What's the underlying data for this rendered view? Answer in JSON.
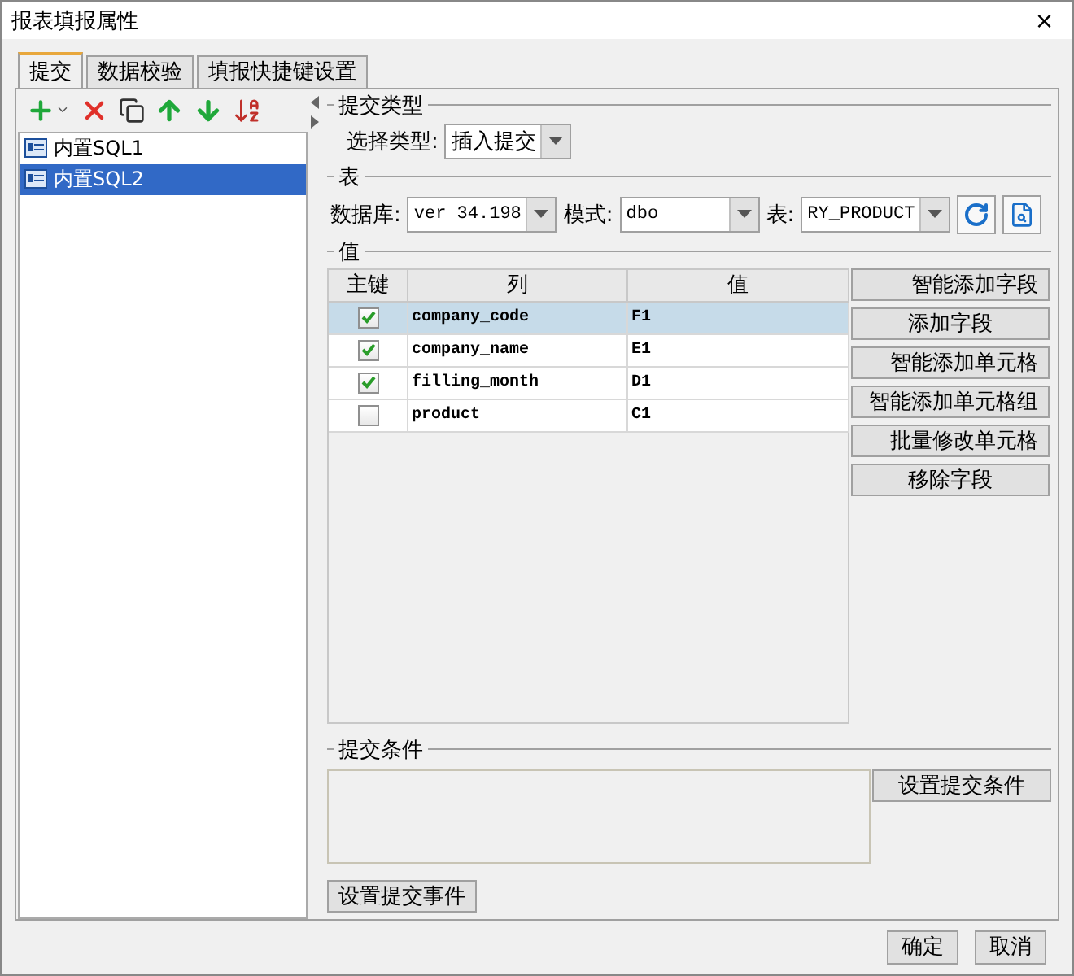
{
  "window": {
    "title": "报表填报属性",
    "close": "×"
  },
  "tabs": [
    {
      "label": "提交",
      "selected": true
    },
    {
      "label": "数据校验",
      "selected": false
    },
    {
      "label": "填报快捷键设置",
      "selected": false
    }
  ],
  "sql_list": [
    {
      "label": "内置SQL1",
      "selected": false
    },
    {
      "label": "内置SQL2",
      "selected": true
    }
  ],
  "submit_type": {
    "legend": "提交类型",
    "label": "选择类型:",
    "value": "插入提交"
  },
  "table_section": {
    "legend": "表",
    "database_label": "数据库:",
    "database": "ver 34.198",
    "schema_label": "模式:",
    "schema": "dbo",
    "table_label": "表:",
    "table": "RY_PRODUCT"
  },
  "values": {
    "legend": "值",
    "columns": [
      "主键",
      "列",
      "值"
    ],
    "rows": [
      {
        "primary_key": true,
        "column": "company_code",
        "value": "F1",
        "selected": true
      },
      {
        "primary_key": true,
        "column": "company_name",
        "value": "E1",
        "selected": false
      },
      {
        "primary_key": true,
        "column": "filling_month",
        "value": "D1",
        "selected": false
      },
      {
        "primary_key": false,
        "column": "product",
        "value": "C1",
        "selected": false
      }
    ],
    "buttons": [
      "智能添加字段",
      "添加字段",
      "智能添加单元格",
      "智能添加单元格组",
      "批量修改单元格",
      "移除字段"
    ]
  },
  "condition": {
    "legend": "提交条件",
    "button": "设置提交条件"
  },
  "event_button": "设置提交事件",
  "footer_buttons": [
    "确定",
    "取消"
  ]
}
